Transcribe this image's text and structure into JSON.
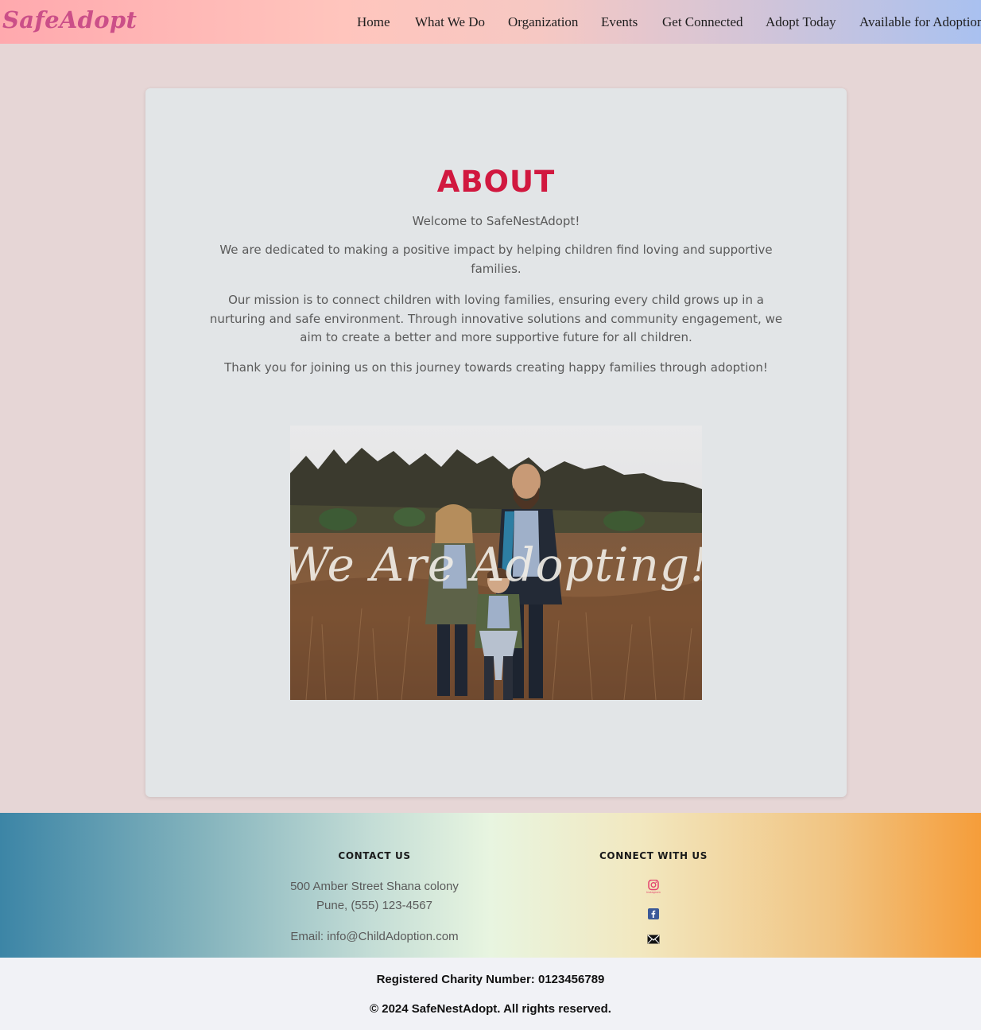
{
  "header": {
    "logo": "SafeAdopt",
    "nav": [
      "Home",
      "What We Do",
      "Organization",
      "Events",
      "Get Connected",
      "Adopt Today",
      "Available for Adoption"
    ]
  },
  "about": {
    "title": "ABOUT",
    "welcome": "Welcome to SafeNestAdopt!",
    "p1": "We are dedicated to making a positive impact by helping children find loving and supportive families.",
    "p2": "Our mission is to connect children with loving families, ensuring every child grows up in a nurturing and safe environment. Through innovative solutions and community engagement, we aim to create a better and more supportive future for all children.",
    "p3": "Thank you for joining us on this journey towards creating happy families through adoption!",
    "image_caption": "We Are Adopting!"
  },
  "footer": {
    "contact_heading": "CONTACT US",
    "address_line1": "500 Amber Street Shana colony",
    "address_line2": "Pune, (555) 123-4567",
    "email": "Email: info@ChildAdoption.com",
    "connect_heading": "CONNECT WITH US",
    "social_icons": [
      "instagram-icon",
      "facebook-icon",
      "email-icon"
    ],
    "instagram_label": "Instagram"
  },
  "bottom": {
    "charity": "Registered Charity Number: 0123456789",
    "copyright": "© 2024 SafeNestAdopt. All rights reserved."
  },
  "colors": {
    "accent_title": "#d1183f",
    "logo": "#cb4f88"
  }
}
